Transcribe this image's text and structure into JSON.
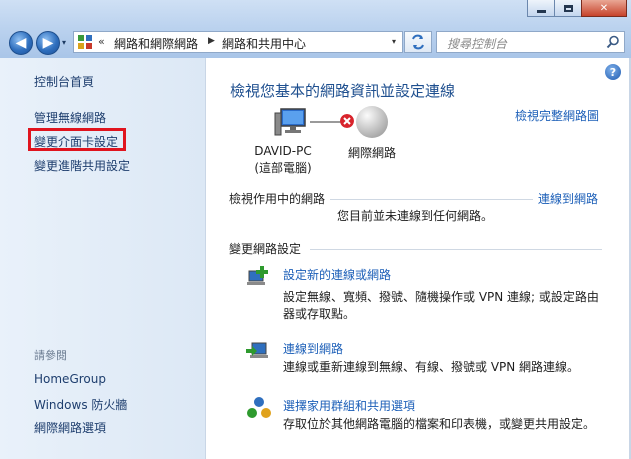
{
  "window": {
    "min_icon": "minimize-icon",
    "max_icon": "maximize-icon",
    "close_glyph": "✕"
  },
  "nav": {
    "back_glyph": "◀",
    "forward_glyph": "▶",
    "recent_glyph": "▾"
  },
  "address": {
    "overflow_glyph": "«",
    "crumbs": [
      "網路和網際網路",
      "網路和共用中心"
    ],
    "separator_glyph": "▶",
    "dropdown_glyph": "▾"
  },
  "search": {
    "placeholder": "搜尋控制台"
  },
  "sidebar": {
    "home": "控制台首頁",
    "links": [
      "管理無線網路",
      "變更介面卡設定",
      "變更進階共用設定"
    ],
    "see_also_heading": "請參閱",
    "see_also": [
      "HomeGroup",
      "Windows 防火牆",
      "網際網路選項"
    ]
  },
  "main": {
    "help_glyph": "?",
    "title": "檢視您基本的網路資訊並設定連線",
    "full_map_link": "檢視完整網路圖",
    "map": {
      "computer_name": "DAVID-PC",
      "computer_sub": "(這部電腦)",
      "network_name": "網際網路"
    },
    "active_networks": {
      "label": "檢視作用中的網路",
      "connect_link": "連線到網路",
      "status": "您目前並未連線到任何網路。"
    },
    "change_settings": {
      "label": "變更網路設定",
      "tasks": [
        {
          "link": "設定新的連線或網路",
          "desc": "設定無線、寬頻、撥號、隨機操作或 VPN 連線; 或設定路由器或存取點。",
          "icon": "new-connection-icon"
        },
        {
          "link": "連線到網路",
          "desc": "連線或重新連線到無線、有線、撥號或 VPN 網路連線。",
          "icon": "connect-network-icon"
        },
        {
          "link": "選擇家用群組和共用選項",
          "desc": "存取位於其他網路電腦的檔案和印表機，或變更共用設定。",
          "icon": "homegroup-icon"
        }
      ]
    }
  },
  "colors": {
    "link": "#1c5fb8",
    "title": "#1e4f8f",
    "highlight_box": "#e0141e",
    "sidebar_bg": "#e9f1fa"
  }
}
